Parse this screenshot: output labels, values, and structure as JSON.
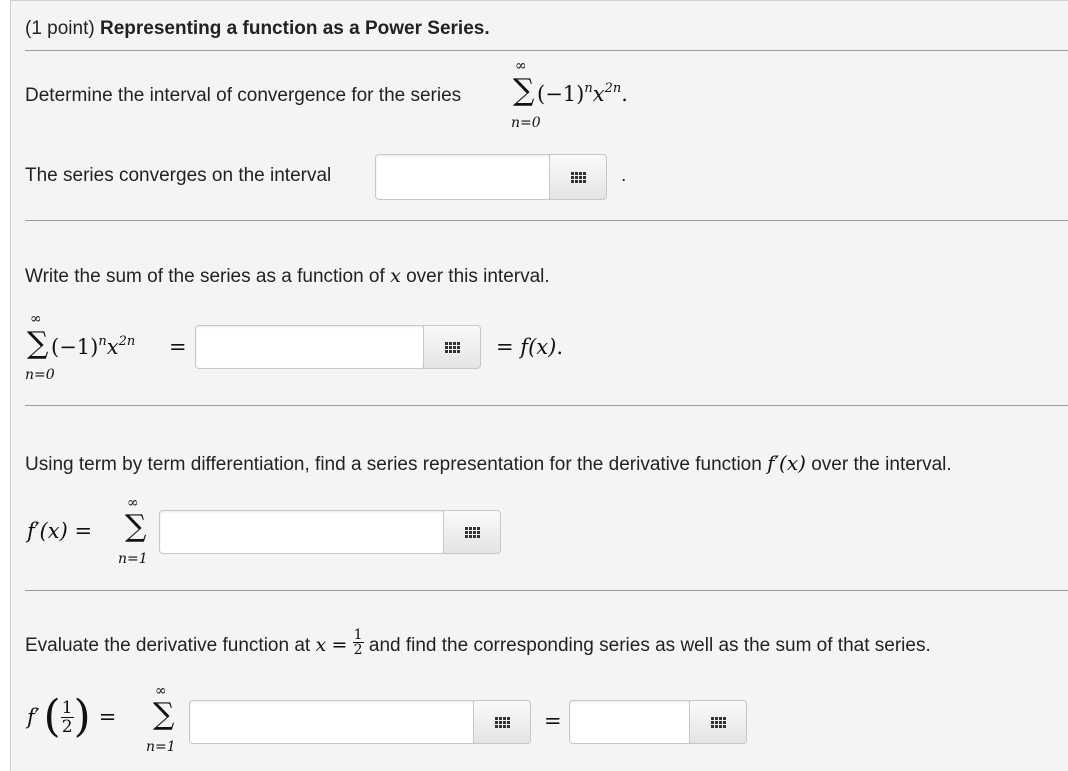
{
  "header": {
    "points": "(1 point)",
    "title": "Representing a function as a Power Series."
  },
  "part1": {
    "prompt": "Determine the interval of convergence for the series",
    "interval_label": "The series converges on the interval",
    "end_period": "."
  },
  "part2": {
    "prompt_before": "Write the sum of the series as a function of",
    "prompt_after": "over this interval."
  },
  "part3": {
    "prompt_before": "Using term by term differentiation, find a series representation for the derivative function",
    "prompt_after": "over the interval."
  },
  "part4": {
    "prompt_before": "Evaluate the derivative function at",
    "prompt_after": "and find the corresponding series as well as the sum of that series."
  },
  "math": {
    "x": "x",
    "fx": "f(x)",
    "equals": "=",
    "term": "(−1)",
    "sup_n": "n",
    "var_x": "x",
    "sup_2n": "2n",
    "sum_top": "∞",
    "sum_bottom_0": "n=0",
    "sum_bottom_1": "n=1",
    "fprime": "f′",
    "fprime_arg": "(x)",
    "half_num": "1",
    "half_den": "2",
    "period": "."
  },
  "inputs": {
    "interval": "",
    "sum_function": "",
    "derivative_series": "",
    "half_series": "",
    "half_sum": ""
  },
  "icons": {
    "keyboard": "equation-editor-grid-icon"
  }
}
